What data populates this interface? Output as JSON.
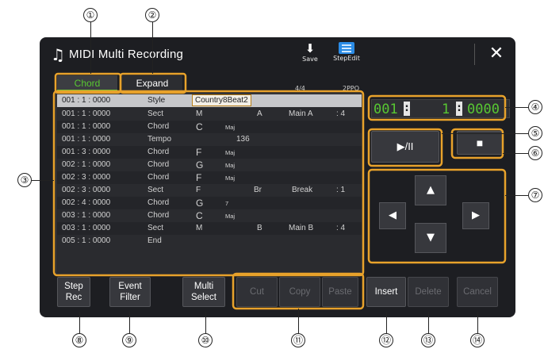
{
  "window": {
    "title": "MIDI Multi Recording",
    "title_icon": "music-notes-icon",
    "save_label": "Save",
    "step_edit_label": "StepEdit",
    "close_glyph": "✕"
  },
  "tabs": [
    {
      "label": "Chord",
      "active": true
    },
    {
      "label": "Expand",
      "active": false
    }
  ],
  "meta": {
    "time_signature": "4/4",
    "ppq": "2PPQ"
  },
  "events": [
    {
      "time": "001 : 1 : 0000",
      "type": "Style",
      "d1": "Country8Beat2",
      "d2": "",
      "d3": "",
      "d4": "",
      "selected": true
    },
    {
      "time": "001 : 1 : 0000",
      "type": "Sect",
      "d1": "M",
      "d2": "A",
      "d3": "Main A",
      "d4": ": 4"
    },
    {
      "time": "001 : 1 : 0000",
      "type": "Chord",
      "d1": "C",
      "d2": "Maj",
      "d3": "",
      "d4": ""
    },
    {
      "time": "001 : 1 : 0000",
      "type": "Tempo",
      "d1": "",
      "d2": "136",
      "d3": "",
      "d4": ""
    },
    {
      "time": "001 : 3 : 0000",
      "type": "Chord",
      "d1": "F",
      "d2": "Maj",
      "d3": "",
      "d4": ""
    },
    {
      "time": "002 : 1 : 0000",
      "type": "Chord",
      "d1": "G",
      "d2": "Maj",
      "d3": "",
      "d4": ""
    },
    {
      "time": "002 : 3 : 0000",
      "type": "Chord",
      "d1": "F",
      "d2": "Maj",
      "d3": "",
      "d4": ""
    },
    {
      "time": "002 : 3 : 0000",
      "type": "Sect",
      "d1": "F",
      "d2": "Br",
      "d3": "Break",
      "d4": ": 1"
    },
    {
      "time": "002 : 4 : 0000",
      "type": "Chord",
      "d1": "G",
      "d2": "7",
      "d3": "",
      "d4": ""
    },
    {
      "time": "003 : 1 : 0000",
      "type": "Chord",
      "d1": "C",
      "d2": "Maj",
      "d3": "",
      "d4": ""
    },
    {
      "time": "003 : 1 : 0000",
      "type": "Sect",
      "d1": "M",
      "d2": "B",
      "d3": "Main B",
      "d4": ": 4"
    },
    {
      "time": "005 : 1 : 0000",
      "type": "End",
      "d1": "",
      "d2": "",
      "d3": "",
      "d4": ""
    }
  ],
  "position": {
    "measure": "001",
    "beat": "1",
    "clock": "0000"
  },
  "transport": {
    "play_pause": "▶/II",
    "stop": "■"
  },
  "cursor_pad": {
    "up": "▲",
    "down": "▼",
    "left": "◀",
    "right": "▶"
  },
  "buttons": {
    "step_rec": [
      "Step",
      "Rec"
    ],
    "event_filter": [
      "Event",
      "Filter"
    ],
    "multi_select": [
      "Multi",
      "Select"
    ],
    "cut": "Cut",
    "copy": "Copy",
    "paste": "Paste",
    "insert": "Insert",
    "delete": "Delete",
    "cancel": "Cancel"
  },
  "callouts": [
    "①",
    "②",
    "③",
    "④",
    "⑤",
    "⑥",
    "⑦",
    "⑧",
    "⑨",
    "⑩",
    "⑪",
    "⑫",
    "⑬",
    "⑭"
  ],
  "colors": {
    "accent_green": "#58c832",
    "highlight_orange": "#e8a22b",
    "screen_bg": "#1d1e22"
  }
}
